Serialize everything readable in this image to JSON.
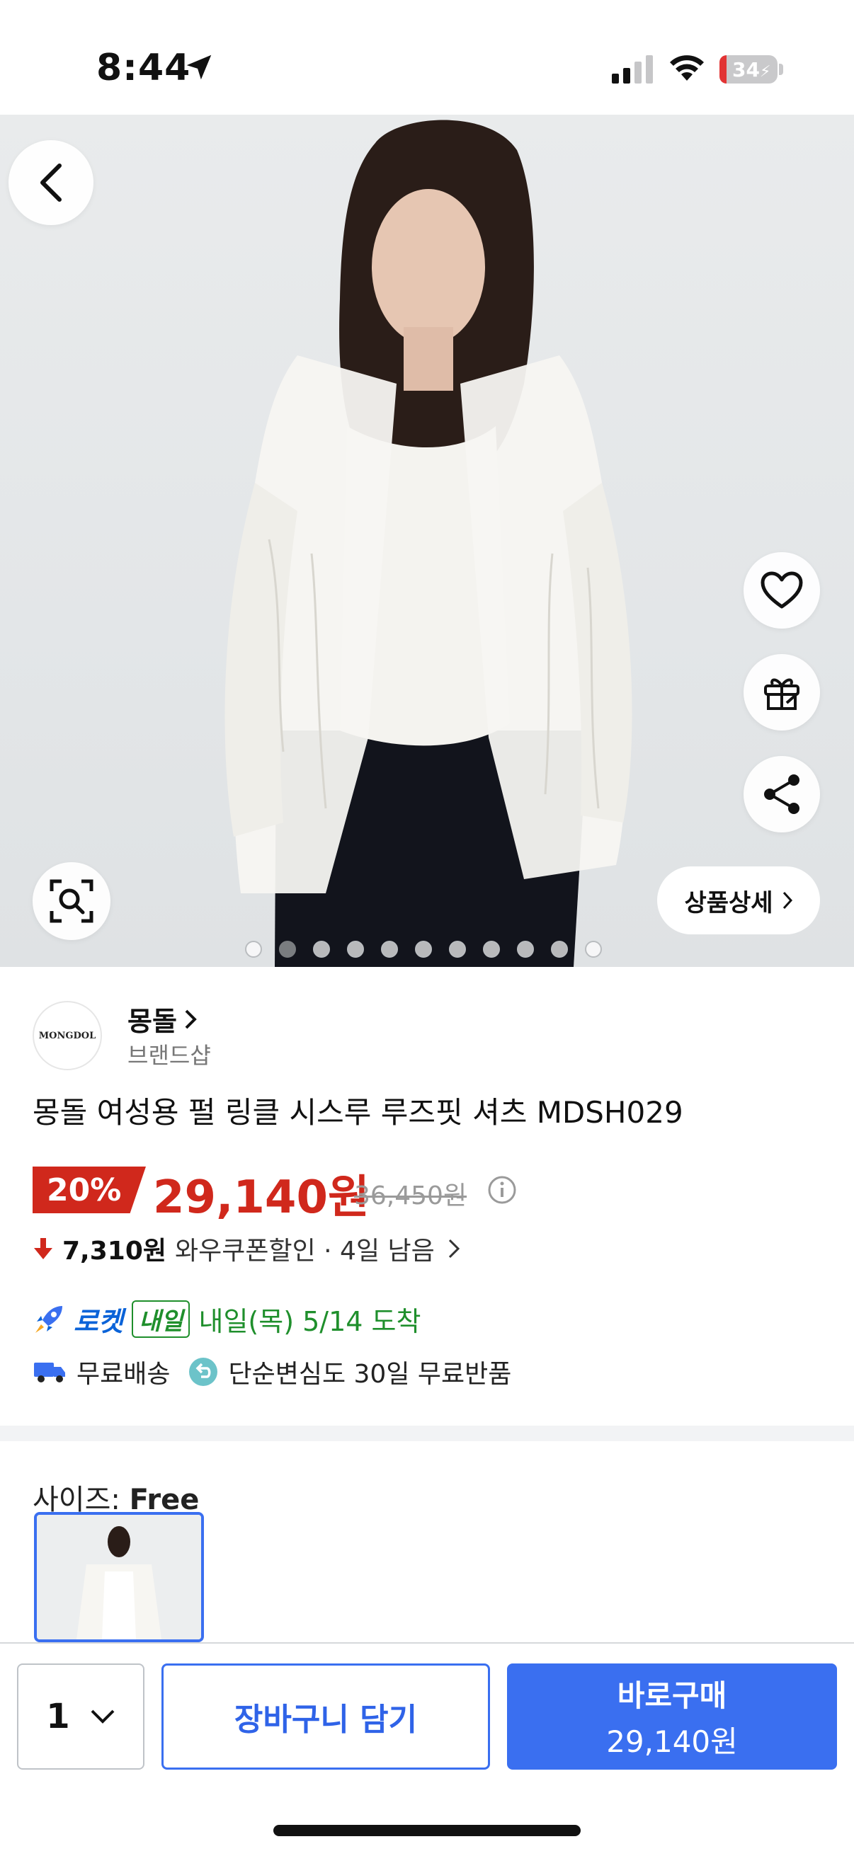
{
  "status_bar": {
    "time": "8:44",
    "battery": "34"
  },
  "hero": {
    "detail_button_label": "상품상세",
    "page_count": 11,
    "active_page": 2
  },
  "brand": {
    "logo_text": "MONGDOL",
    "name": "몽돌",
    "subtitle": "브랜드샵"
  },
  "product": {
    "title": "몽돌 여성용 펄 링클 시스루 루즈핏 셔츠 MDSH029",
    "discount": "20%",
    "price": "29,140원",
    "original_price": "36,450원",
    "coupon_amount": "7,310원",
    "coupon_desc": "와우쿠폰할인 · 4일 남음"
  },
  "delivery": {
    "rocket_label": "로켓",
    "tomorrow_badge": "내일",
    "arrival_text": "내일(목) 5/14 도착",
    "free_shipping": "무료배송",
    "free_return": "단순변심도 30일 무료반품"
  },
  "options": {
    "size_prefix": "사이즈: ",
    "size_value": "Free"
  },
  "bottom_bar": {
    "quantity": "1",
    "cart_label": "장바구니 담기",
    "buy_label": "바로구매",
    "buy_price": "29,140원"
  },
  "colors": {
    "accent_blue": "#3a6ff0",
    "sale_red": "#d0281c",
    "rocket_blue": "#0b63d8",
    "arrival_green": "#1f8f2c"
  }
}
